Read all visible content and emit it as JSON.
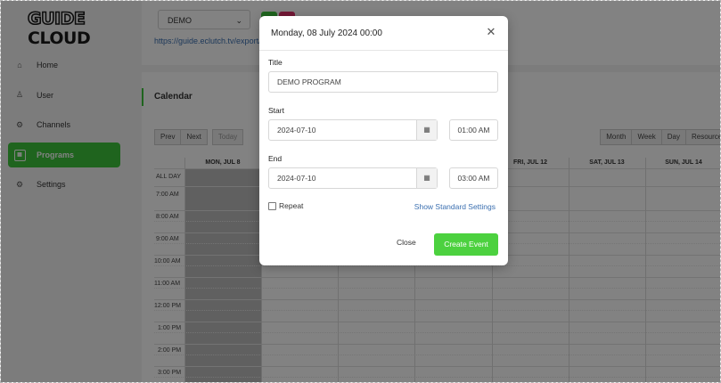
{
  "app": {
    "logo_part1": "GUIDE",
    "logo_part2": "CLOUD"
  },
  "sidebar": {
    "items": [
      {
        "label": "Home",
        "icon": "home-icon"
      },
      {
        "label": "User",
        "icon": "user-icon"
      },
      {
        "label": "Channels",
        "icon": "channels-gear-icon"
      },
      {
        "label": "Programs",
        "icon": "calendar-icon",
        "active": true
      },
      {
        "label": "Settings",
        "icon": "settings-gear-icon"
      }
    ]
  },
  "topbar": {
    "channel_select": "DEMO",
    "export_url": "https://guide.eclutch.tv/export/c"
  },
  "calendar": {
    "title": "Calendar",
    "nav_buttons": {
      "prev": "Prev",
      "next": "Next",
      "today": "Today"
    },
    "view_buttons": [
      "Month",
      "Week",
      "Day",
      "Resource"
    ],
    "day_headers": [
      "MON, JUL 8",
      "",
      "",
      "",
      "FRI, JUL 12",
      "SAT, JUL 13",
      "SUN, JUL 14"
    ],
    "allday_label": "ALL DAY",
    "times": [
      "7:00 AM",
      "8:00 AM",
      "9:00 AM",
      "10:00 AM",
      "11:00 AM",
      "12:00 PM",
      "1:00 PM",
      "2:00 PM",
      "3:00 PM"
    ]
  },
  "modal": {
    "header": "Monday, 08 July 2024 00:00",
    "title_label": "Title",
    "title_value": "DEMO PROGRAM",
    "start_label": "Start",
    "start_date": "2024-07-10",
    "start_time": "01:00 AM",
    "end_label": "End",
    "end_date": "2024-07-10",
    "end_time": "03:00 AM",
    "repeat_label": "Repeat",
    "standard_settings_link": "Show Standard Settings",
    "close_label": "Close",
    "create_label": "Create Event"
  },
  "colors": {
    "accent": "#3ec43c",
    "link": "#3a6fb0"
  }
}
